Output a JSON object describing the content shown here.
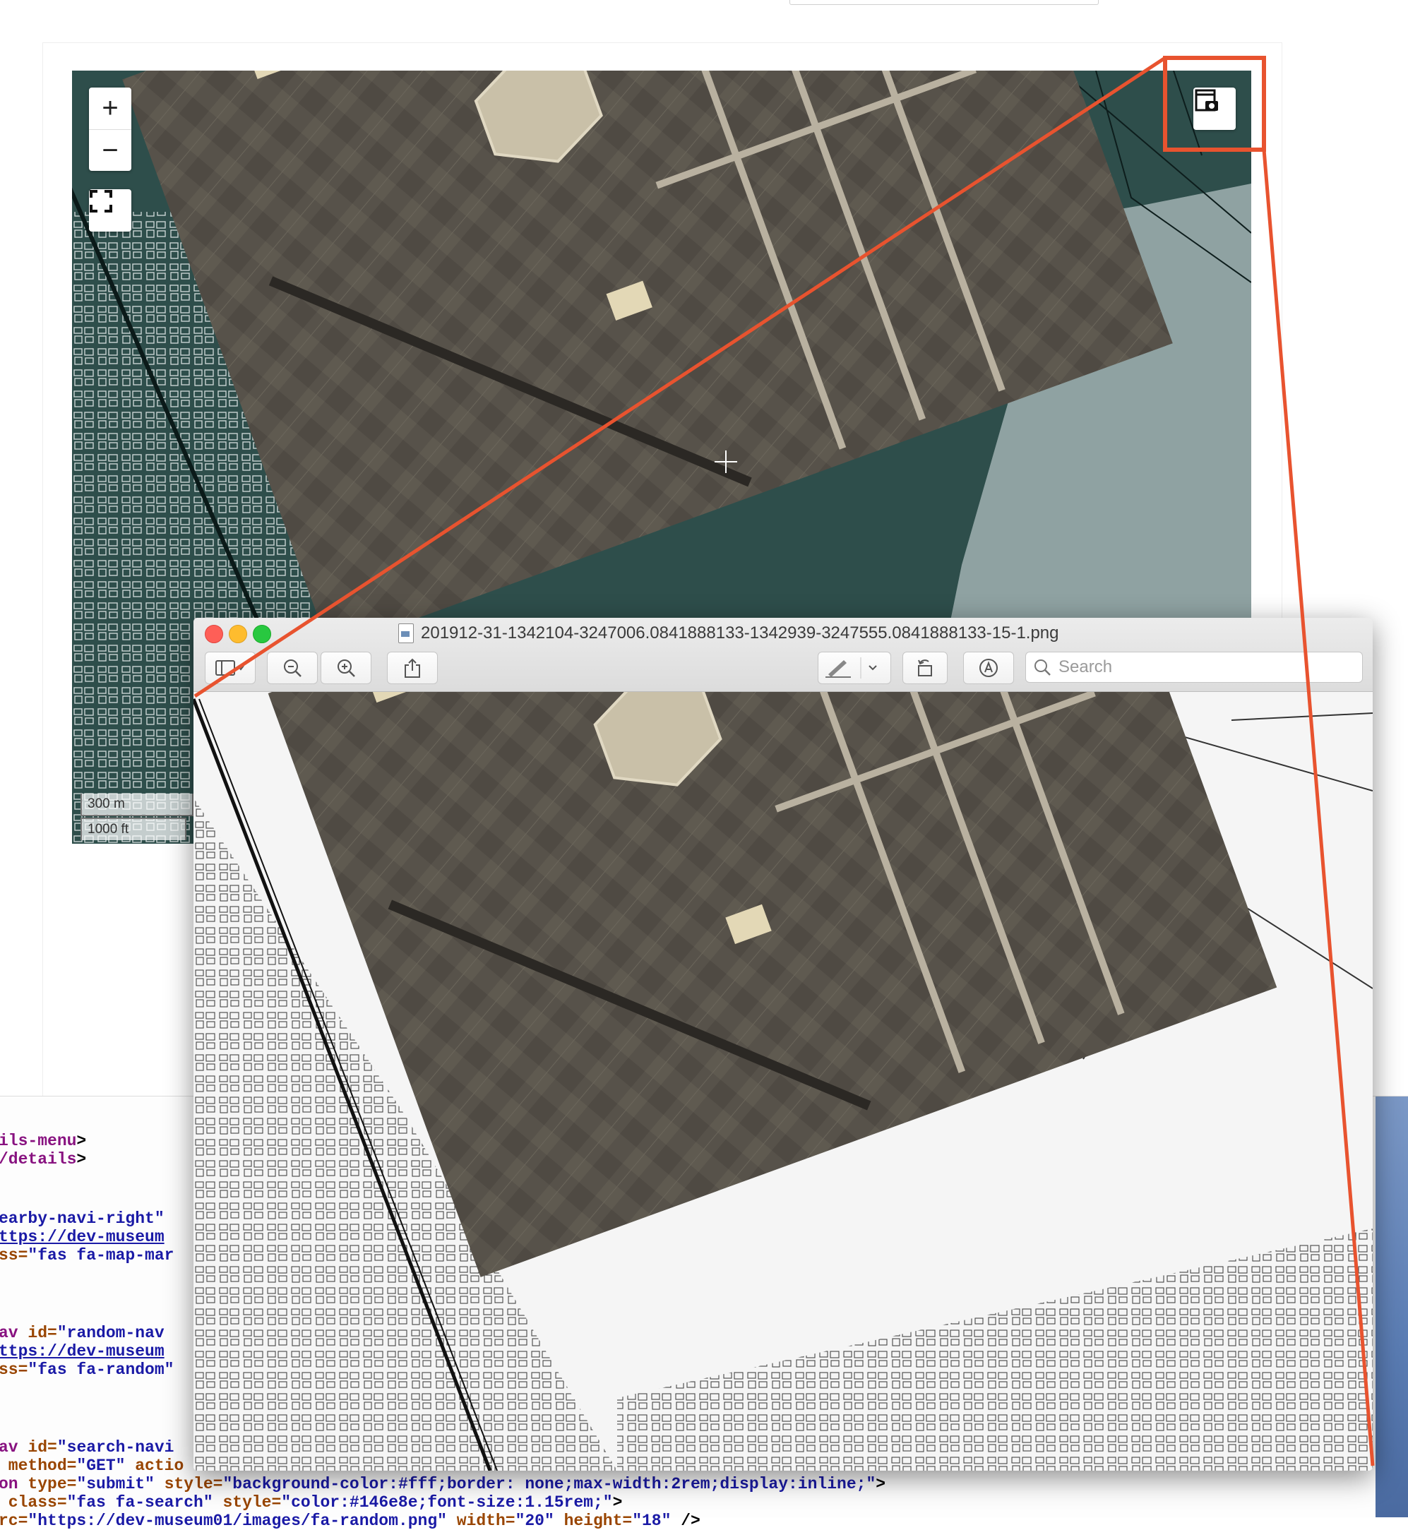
{
  "map": {
    "zoom_in_label": "+",
    "zoom_out_label": "−",
    "scale_metric": "300 m",
    "scale_imperial": "1000 ft",
    "icons": {
      "fullscreen": "fullscreen-icon",
      "screenshot": "camera-screenshot-icon"
    },
    "colors": {
      "base_land": "#2e4e4b",
      "water": "#8fa2a2",
      "aerial_tone": "#5a554c",
      "highlight": "#e8532f"
    }
  },
  "preview_window": {
    "title": "201912-31-1342104-3247006.0841888133-1342939-3247555.0841888133-15-1.png",
    "search_placeholder": "Search",
    "toolbar_icons": [
      "sidebar-icon",
      "zoom-out-icon",
      "zoom-in-icon",
      "share-icon",
      "markup-pen-icon",
      "chevron-down-icon",
      "rotate-icon",
      "markup-toolbar-icon",
      "search-icon"
    ]
  },
  "source_code": {
    "lines": [
      {
        "segments": [
          {
            "t": "ils-menu",
            "c": "tag"
          },
          {
            "t": ">",
            "c": "plain"
          }
        ]
      },
      {
        "segments": [
          {
            "t": "/details",
            "c": "tag"
          },
          {
            "t": ">",
            "c": "plain"
          }
        ]
      },
      {
        "segments": [
          {
            "t": "earby-navi-right",
            "c": "val"
          },
          {
            "t": "\"",
            "c": "val"
          }
        ]
      },
      {
        "segments": [
          {
            "t": "ttps://dev-museum",
            "c": "link"
          }
        ]
      },
      {
        "segments": [
          {
            "t": "ss=",
            "c": "attr"
          },
          {
            "t": "\"fas fa-map-mar",
            "c": "val"
          }
        ]
      },
      {
        "segments": [
          {
            "t": "av ",
            "c": "tag"
          },
          {
            "t": "id=",
            "c": "attr"
          },
          {
            "t": "\"random-nav",
            "c": "val"
          }
        ]
      },
      {
        "segments": [
          {
            "t": "ttps://dev-museum",
            "c": "link"
          }
        ]
      },
      {
        "segments": [
          {
            "t": "ss=",
            "c": "attr"
          },
          {
            "t": "\"fas fa-random\"",
            "c": "val"
          }
        ]
      },
      {
        "segments": [
          {
            "t": "av ",
            "c": "tag"
          },
          {
            "t": "id=",
            "c": "attr"
          },
          {
            "t": "\"search-navi",
            "c": "val"
          }
        ]
      },
      {
        "segments": [
          {
            "t": " method=",
            "c": "attr"
          },
          {
            "t": "\"GET\" ",
            "c": "val"
          },
          {
            "t": "actio",
            "c": "attr"
          }
        ]
      },
      {
        "segments": [
          {
            "t": "on ",
            "c": "tag"
          },
          {
            "t": "type=",
            "c": "attr"
          },
          {
            "t": "\"submit\" ",
            "c": "val"
          },
          {
            "t": "style=",
            "c": "attr"
          },
          {
            "t": "\"background-color:#fff;border: none;max-width:2rem;display:inline;\"",
            "c": "val"
          },
          {
            "t": ">",
            "c": "plain"
          }
        ]
      },
      {
        "segments": [
          {
            "t": " class=",
            "c": "attr"
          },
          {
            "t": "\"fas fa-search\" ",
            "c": "val"
          },
          {
            "t": "style=",
            "c": "attr"
          },
          {
            "t": "\"color:#146e8e;font-size:1.15rem;\"",
            "c": "val"
          },
          {
            "t": ">",
            "c": "plain"
          }
        ]
      },
      {
        "segments": [
          {
            "t": "rc=",
            "c": "attr"
          },
          {
            "t": "\"https://dev-museum01/images/fa-random.png\" ",
            "c": "val"
          },
          {
            "t": "width=",
            "c": "attr"
          },
          {
            "t": "\"20\" ",
            "c": "val"
          },
          {
            "t": "height=",
            "c": "attr"
          },
          {
            "t": "\"18\" ",
            "c": "val"
          },
          {
            "t": "/>",
            "c": "plain"
          }
        ]
      }
    ]
  }
}
